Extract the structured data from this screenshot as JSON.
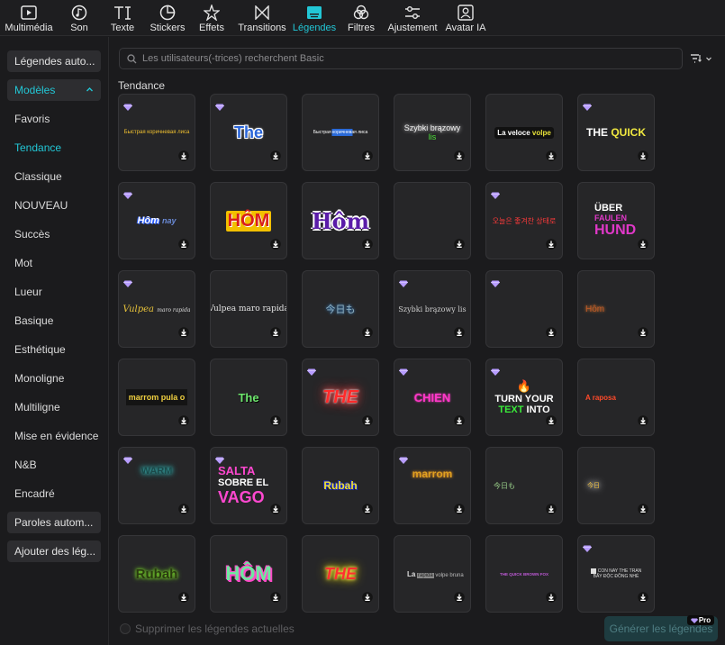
{
  "toolbar": {
    "tabs": [
      {
        "label": "Multimédia",
        "icon": "media-icon"
      },
      {
        "label": "Son",
        "icon": "music-icon"
      },
      {
        "label": "Texte",
        "icon": "text-icon"
      },
      {
        "label": "Stickers",
        "icon": "sticker-icon"
      },
      {
        "label": "Effets",
        "icon": "effects-icon"
      },
      {
        "label": "Transitions",
        "icon": "transitions-icon"
      },
      {
        "label": "Légendes",
        "icon": "captions-icon",
        "active": true
      },
      {
        "label": "Filtres",
        "icon": "filters-icon"
      },
      {
        "label": "Ajustement",
        "icon": "adjust-icon"
      },
      {
        "label": "Avatar IA",
        "icon": "ai-avatar-icon"
      }
    ]
  },
  "sidebar": {
    "auto_captions": "Légendes auto...",
    "templates": "Modèles",
    "items": [
      "Favoris",
      "Tendance",
      "Classique",
      "NOUVEAU",
      "Succès",
      "Mot",
      "Lueur",
      "Basique",
      "Esthétique",
      "Monoligne",
      "Multiligne",
      "Mise en évidence",
      "N&B",
      "Encadré"
    ],
    "auto_lyrics": "Paroles autom...",
    "add_captions": "Ajouter des lég..."
  },
  "search": {
    "placeholder": "Les utilisateurs(-trices) recherchent Basic"
  },
  "section_title": "Tendance",
  "cards": [
    {
      "text": "Быстрая коричневая лиса",
      "pro": true
    },
    {
      "text": "The",
      "pro": true
    },
    {
      "text": "Быстрая коричневая лиса",
      "pro": false
    },
    {
      "text": "Szybki brązowy",
      "text2": "lis",
      "pro": false
    },
    {
      "text": "La veloce",
      "text2": "volpe",
      "pro": false
    },
    {
      "text": "THE",
      "text2": "QUICK",
      "pro": true
    },
    {
      "text": "Hôm",
      "text2": "nay",
      "pro": true
    },
    {
      "text": "HÔM",
      "pro": false
    },
    {
      "text": "Hôm",
      "pro": false
    },
    {
      "text": "",
      "pro": false
    },
    {
      "text": "오늘은 좋겨찬 상태로",
      "pro": true
    },
    {
      "text": "ÜBER",
      "text2": "FAULEN",
      "text3": "HUND",
      "pro": false
    },
    {
      "text": "Vulpea",
      "text2": "maro rapida",
      "pro": true
    },
    {
      "text": "Vulpea maro rapida",
      "pro": false
    },
    {
      "text": "今日も",
      "pro": false
    },
    {
      "text": "Szybki brązowy lis",
      "pro": true
    },
    {
      "text": "",
      "pro": true
    },
    {
      "text": "Hôm",
      "pro": false
    },
    {
      "text": "marrom pula o",
      "pro": false
    },
    {
      "text": "The",
      "pro": false
    },
    {
      "text": "THE",
      "pro": true
    },
    {
      "text": "CHIEN",
      "pro": true
    },
    {
      "text": "🔥",
      "text2": "TURN YOUR",
      "text3": "TEXT",
      "text4": "INTO",
      "pro": true
    },
    {
      "text": "A raposa",
      "pro": false
    },
    {
      "text": "WARM",
      "pro": true
    },
    {
      "text": "SALTA",
      "text2": "SOBRE EL",
      "text3": "VAGO",
      "pro": true
    },
    {
      "text": "Rubah",
      "pro": false
    },
    {
      "text": "marrom",
      "pro": true
    },
    {
      "text": "今日も",
      "pro": false
    },
    {
      "text": "今日",
      "pro": false
    },
    {
      "text": "Rubah",
      "pro": false
    },
    {
      "text": "HÔM",
      "pro": false
    },
    {
      "text": "THE",
      "pro": false
    },
    {
      "text": "La",
      "text2": "rapida",
      "text3": "volpe bruna",
      "pro": false
    },
    {
      "text": "THE QUICK BROWN FOX",
      "pro": false
    },
    {
      "text": "CON NAY THE TRAN",
      "text2": "BẤY ĐỘC ĐỒNG NHÉ",
      "pro": true
    }
  ],
  "bottom": {
    "checkbox_label": "Supprimer les légendes actuelles",
    "generate_button": "Générer les légendes",
    "pro_badge": "Pro"
  },
  "colors": {
    "accent": "#22c7d6",
    "pro_gem": "#b79cff"
  }
}
